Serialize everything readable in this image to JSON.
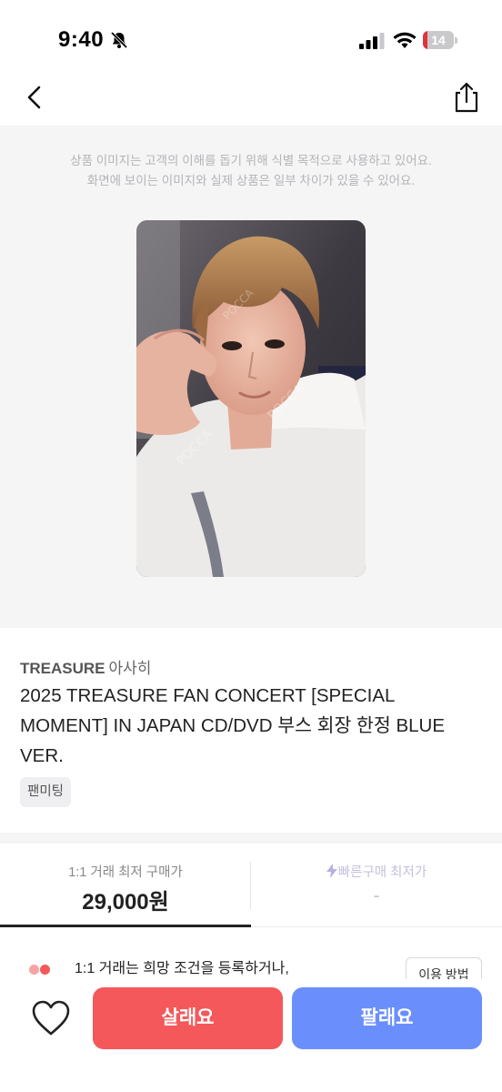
{
  "status_bar": {
    "time": "9:40",
    "battery_level": "14",
    "battery_fraction": 0.14,
    "icons": [
      "bell-slash-icon",
      "signal-icon",
      "wifi-icon",
      "battery-icon"
    ]
  },
  "nav": {
    "back_icon": "chevron-left-icon",
    "share_icon": "share-icon"
  },
  "image_notice": {
    "line1": "상품 이미지는 고객의 이해를 돕기 위해 식별 목적으로 사용하고 있어요.",
    "line2": "화면에 보이는 이미지와 실제 상품은 일부 차이가 있을 수 있어요."
  },
  "product": {
    "artist": "TREASURE",
    "member": "아사히",
    "title": "2025 TREASURE FAN CONCERT [SPECIAL MOMENT] IN JAPAN CD/DVD 부스 회장 한정 BLUE VER.",
    "tag": "팬미팅"
  },
  "price_tabs": [
    {
      "label": "1:1 거래 최저 구매가",
      "value": "29,000원",
      "active": true
    },
    {
      "label": "빠른구매 최저가",
      "value": "-",
      "active": false
    }
  ],
  "info": {
    "text": "1:1 거래는 희망 조건을 등록하거나,",
    "usage_button": "이용 방법"
  },
  "bottom_bar": {
    "buy_label": "살래요",
    "sell_label": "팔래요"
  },
  "colors": {
    "buy": "#f4585a",
    "sell": "#6a8ffd",
    "battery_low": "#e0333a"
  }
}
